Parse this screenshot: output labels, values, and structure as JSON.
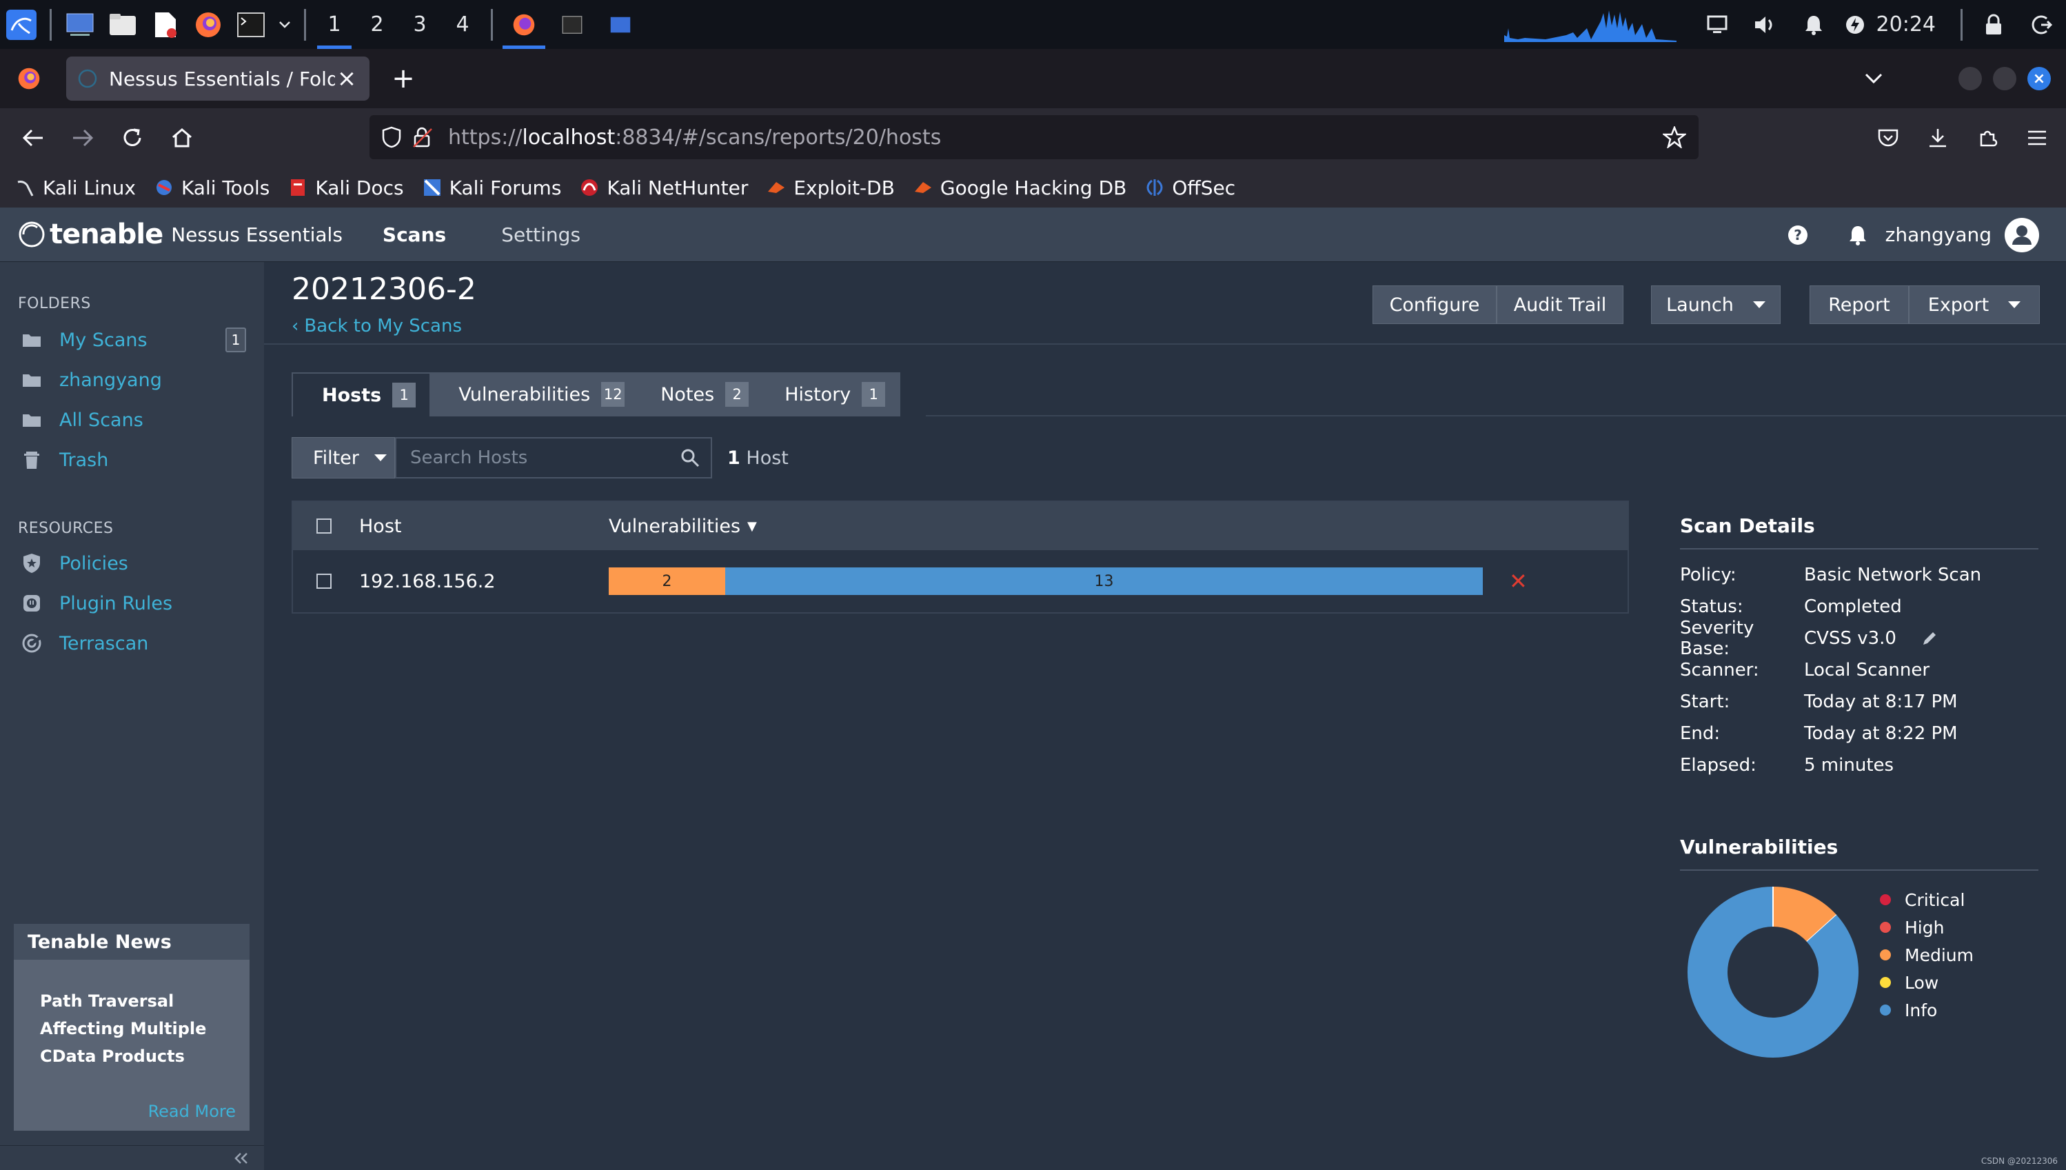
{
  "taskbar": {
    "workspaces": [
      "1",
      "2",
      "3",
      "4"
    ],
    "clock": "20:24"
  },
  "browser": {
    "tab_title": "Nessus Essentials / Folders",
    "url_scheme": "https://",
    "url_host": "localhost",
    "url_rest": ":8834/#/scans/reports/20/hosts",
    "bookmarks": [
      "Kali Linux",
      "Kali Tools",
      "Kali Docs",
      "Kali Forums",
      "Kali NetHunter",
      "Exploit-DB",
      "Google Hacking DB",
      "OffSec"
    ]
  },
  "app": {
    "brand": "tenable",
    "product": "Nessus Essentials",
    "nav": [
      "Scans",
      "Settings"
    ],
    "user": "zhangyang"
  },
  "sidebar": {
    "folders_label": "FOLDERS",
    "folders": [
      {
        "label": "My Scans",
        "icon": "folder-icon",
        "badge": "1"
      },
      {
        "label": "zhangyang",
        "icon": "folder-icon"
      },
      {
        "label": "All Scans",
        "icon": "folder-icon"
      },
      {
        "label": "Trash",
        "icon": "trash-icon"
      }
    ],
    "resources_label": "RESOURCES",
    "resources": [
      {
        "label": "Policies",
        "icon": "shield-icon"
      },
      {
        "label": "Plugin Rules",
        "icon": "plug-icon"
      },
      {
        "label": "Terrascan",
        "icon": "radar-icon"
      }
    ],
    "news": {
      "title": "Tenable News",
      "headline": "Path Traversal Affecting Multiple CData Products",
      "read_more": "Read More"
    }
  },
  "scan": {
    "title": "20212306-2",
    "back": "Back to My Scans",
    "buttons": {
      "configure": "Configure",
      "audit": "Audit Trail",
      "launch": "Launch",
      "report": "Report",
      "export": "Export"
    },
    "tabs": [
      {
        "label": "Hosts",
        "count": "1"
      },
      {
        "label": "Vulnerabilities",
        "count": "12"
      },
      {
        "label": "Notes",
        "count": "2"
      },
      {
        "label": "History",
        "count": "1"
      }
    ],
    "filter_label": "Filter",
    "search_placeholder": "Search Hosts",
    "host_count": "1",
    "host_count_label": "Host",
    "table": {
      "col_host": "Host",
      "col_vuln": "Vulnerabilities",
      "rows": [
        {
          "host": "192.168.156.2",
          "medium": 2,
          "info": 13
        }
      ]
    }
  },
  "details": {
    "title": "Scan Details",
    "rows": [
      {
        "k": "Policy:",
        "v": "Basic Network Scan"
      },
      {
        "k": "Status:",
        "v": "Completed"
      },
      {
        "k": "Severity Base:",
        "v": "CVSS v3.0"
      },
      {
        "k": "Scanner:",
        "v": "Local Scanner"
      },
      {
        "k": "Start:",
        "v": "Today at 8:17 PM"
      },
      {
        "k": "End:",
        "v": "Today at 8:22 PM"
      },
      {
        "k": "Elapsed:",
        "v": "5 minutes"
      }
    ]
  },
  "vulns": {
    "title": "Vulnerabilities",
    "legend": [
      {
        "label": "Critical",
        "color": "#d6223f"
      },
      {
        "label": "High",
        "color": "#e9504c"
      },
      {
        "label": "Medium",
        "color": "#fd9a4d"
      },
      {
        "label": "Low",
        "color": "#fddc3c"
      },
      {
        "label": "Info",
        "color": "#4c94d1"
      }
    ],
    "counts": {
      "critical": 0,
      "high": 0,
      "medium": 2,
      "low": 0,
      "info": 13
    }
  },
  "watermark": "CSDN @20212306"
}
